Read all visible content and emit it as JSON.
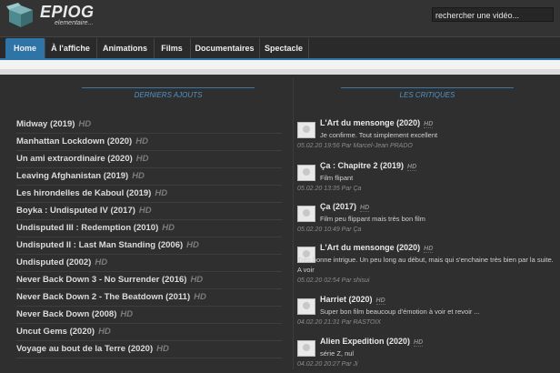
{
  "header": {
    "logo_text": "EPIOG",
    "logo_tagline": "elementaire...",
    "search_placeholder": "rechercher une vidéo..."
  },
  "nav": {
    "items": [
      "Home",
      "À l'affiche",
      "Animations",
      "Films",
      "Documentaires",
      "Spectacle"
    ]
  },
  "left": {
    "title": "DERNIERS AJOUTS",
    "movies": [
      {
        "title": "Midway (2019)",
        "badge": "HD"
      },
      {
        "title": "Manhattan Lockdown (2020)",
        "badge": "HD"
      },
      {
        "title": "Un ami extraordinaire (2020)",
        "badge": "HD"
      },
      {
        "title": "Leaving Afghanistan (2019)",
        "badge": "HD"
      },
      {
        "title": "Les hirondelles de Kaboul (2019)",
        "badge": "HD"
      },
      {
        "title": "Boyka : Undisputed IV (2017)",
        "badge": "HD"
      },
      {
        "title": "Undisputed III : Redemption (2010)",
        "badge": "HD"
      },
      {
        "title": "Undisputed II : Last Man Standing (2006)",
        "badge": "HD"
      },
      {
        "title": "Undisputed (2002)",
        "badge": "HD"
      },
      {
        "title": "Never Back Down 3 - No Surrender (2016)",
        "badge": "HD"
      },
      {
        "title": "Never Back Down 2 - The Beatdown (2011)",
        "badge": "HD"
      },
      {
        "title": "Never Back Down (2008)",
        "badge": "HD"
      },
      {
        "title": "Uncut Gems (2020)",
        "badge": "HD"
      },
      {
        "title": "Voyage au bout de la Terre (2020)",
        "badge": "HD"
      }
    ]
  },
  "right": {
    "title": "LES CRITIQUES",
    "reviews": [
      {
        "title": "L'Art du mensonge (2020)",
        "badge": "HD",
        "text": "Je confirme. Tout simplement excellent",
        "meta": "05.02.20 19:56 Par Marcel-Jean PRADO"
      },
      {
        "title": "Ça : Chapitre 2 (2019)",
        "badge": "HD",
        "text": "Film flipant",
        "meta": "05.02.20 13:35 Par Ça"
      },
      {
        "title": "Ça (2017)",
        "badge": "HD",
        "text": "Film peu flippant mais très bon film",
        "meta": "05.02.20 10:49 Par Ça"
      },
      {
        "title": "L'Art du mensonge (2020)",
        "badge": "HD",
        "text": "Très bonne intrigue. Un peu long au début, mais qui s'enchaine très bien par la suite. A voir",
        "meta": "05.02.20 02:54 Par shisui"
      },
      {
        "title": "Harriet (2020)",
        "badge": "HD",
        "text": "Super bon film beaucoup d'émotion à voir et revoir ...",
        "meta": "04.02.20 21:31 Par RASTOIX"
      },
      {
        "title": "Alien Expedition (2020)",
        "badge": "HD",
        "text": "série Z, nul",
        "meta": "04.02.20 20:27 Par Ji"
      }
    ]
  }
}
